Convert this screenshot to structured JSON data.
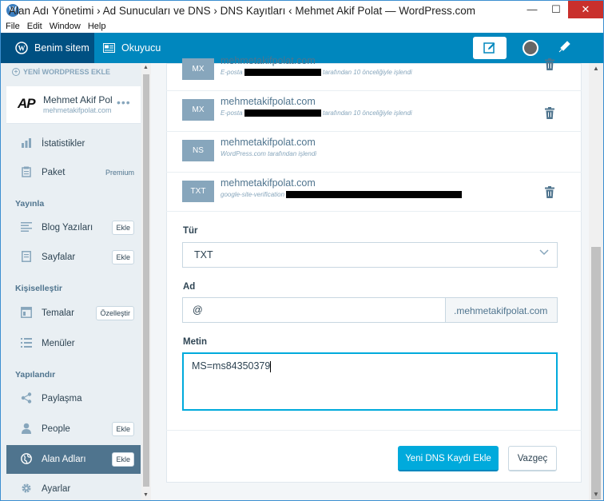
{
  "window": {
    "title": "Alan Adı Yönetimi › Ad Sunucuları ve DNS › DNS Kayıtları ‹ Mehmet Akif Polat — WordPress.com",
    "minimize": "—",
    "maximize": "☐",
    "close": "✕"
  },
  "menu": [
    "File",
    "Edit",
    "Window",
    "Help"
  ],
  "masterbar": {
    "my_site": "Benim sitem",
    "reader": "Okuyucu"
  },
  "sidebar": {
    "add_site": "YENİ WORDPRESS EKLE",
    "site_logo": "AP",
    "site_name": "Mehmet Akif Polat",
    "site_url": "mehmetakifpolat.com",
    "more": "•••",
    "stats": "İstatistikler",
    "plan": "Paket",
    "plan_badge": "Premium",
    "publish_heading": "Yayınla",
    "posts": "Blog Yazıları",
    "posts_btn": "Ekle",
    "pages": "Sayfalar",
    "pages_btn": "Ekle",
    "personalize_heading": "Kişiselleştir",
    "themes": "Temalar",
    "themes_btn": "Özelleştir",
    "menus": "Menüler",
    "configure_heading": "Yapılandır",
    "sharing": "Paylaşma",
    "people": "People",
    "people_btn": "Ekle",
    "domains": "Alan Adları",
    "domains_btn": "Ekle",
    "settings": "Ayarlar"
  },
  "records": [
    {
      "type": "MX",
      "name": "mehmetakifpolat.com",
      "desc_before": "E-posta",
      "desc_after": "tarafından 10 önceliğiyle işlendi",
      "redacted": true,
      "deletable": true
    },
    {
      "type": "MX",
      "name": "mehmetakifpolat.com",
      "desc_before": "E-posta",
      "desc_after": "tarafından 10 önceliğiyle işlendi",
      "redacted": true,
      "deletable": true
    },
    {
      "type": "NS",
      "name": "mehmetakifpolat.com",
      "desc_before": "WordPress.com tarafından işlendi",
      "desc_after": "",
      "redacted": false,
      "deletable": false
    },
    {
      "type": "TXT",
      "name": "mehmetakifpolat.com",
      "desc_before": "google-site-verification",
      "desc_after": "",
      "redacted": true,
      "deletable": true
    }
  ],
  "form": {
    "type_label": "Tür",
    "type_value": "TXT",
    "name_label": "Ad",
    "name_value": "@",
    "name_suffix": ".mehmetakifpolat.com",
    "text_label": "Metin",
    "text_value": "MS=ms84350379",
    "submit": "Yeni DNS Kaydı Ekle",
    "cancel": "Vazgeç"
  }
}
